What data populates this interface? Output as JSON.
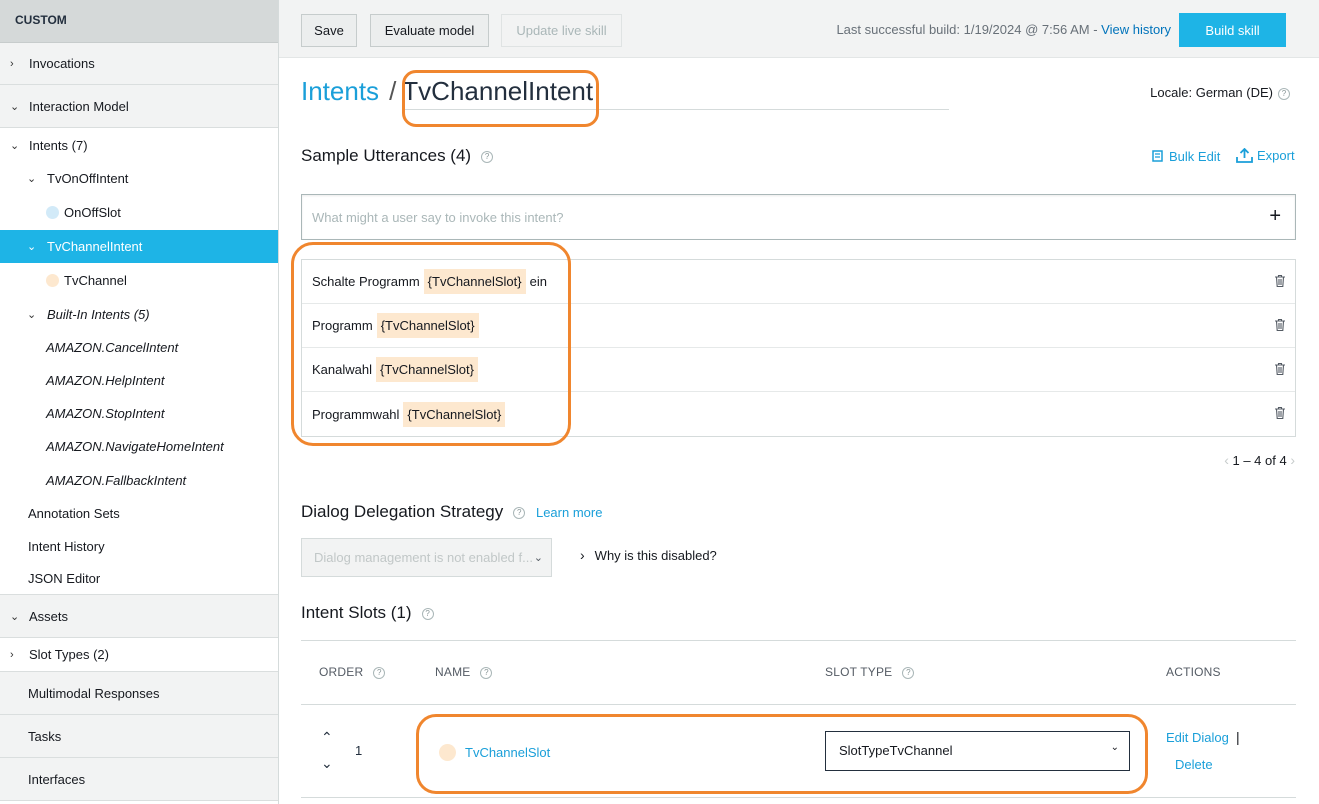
{
  "sidebar": {
    "header": "CUSTOM",
    "items": [
      {
        "label": "Invocations"
      },
      {
        "label": "Interaction Model"
      },
      {
        "label": "Intents (7)"
      },
      {
        "label": "TvOnOffIntent"
      },
      {
        "label": "OnOffSlot"
      },
      {
        "label": "TvChannelIntent"
      },
      {
        "label": "TvChannel"
      },
      {
        "label": "Built-In Intents (5)"
      },
      {
        "label": "AMAZON.CancelIntent"
      },
      {
        "label": "AMAZON.HelpIntent"
      },
      {
        "label": "AMAZON.StopIntent"
      },
      {
        "label": "AMAZON.NavigateHomeIntent"
      },
      {
        "label": "AMAZON.FallbackIntent"
      },
      {
        "label": "Annotation Sets"
      },
      {
        "label": "Intent History"
      },
      {
        "label": "JSON Editor"
      },
      {
        "label": "Assets"
      },
      {
        "label": "Slot Types (2)"
      },
      {
        "label": "Multimodal Responses"
      },
      {
        "label": "Tasks"
      },
      {
        "label": "Interfaces"
      }
    ]
  },
  "toolbar": {
    "save": "Save",
    "evaluate": "Evaluate model",
    "update": "Update live skill",
    "build_info": "Last successful build: 1/19/2024 @ 7:56 AM -",
    "view_history": "View history",
    "build": "Build skill"
  },
  "breadcrumb": {
    "parent": "Intents",
    "separator": "/",
    "current": "TvChannelIntent"
  },
  "locale": "Locale: German (DE)",
  "utterances": {
    "title": "Sample Utterances (4)",
    "bulk_edit": "Bulk Edit",
    "export": "Export",
    "placeholder": "What might a user say to invoke this intent?",
    "rows": [
      {
        "before": "Schalte Programm",
        "slot": "{TvChannelSlot}",
        "after": "ein"
      },
      {
        "before": "Programm",
        "slot": "{TvChannelSlot}",
        "after": ""
      },
      {
        "before": "Kanalwahl",
        "slot": "{TvChannelSlot}",
        "after": ""
      },
      {
        "before": "Programmwahl",
        "slot": "{TvChannelSlot}",
        "after": ""
      }
    ],
    "pager": "1 – 4 of 4"
  },
  "dialog": {
    "title": "Dialog Delegation Strategy",
    "learn_more": "Learn more",
    "select_value": "Dialog management is not enabled f...",
    "why": "Why is this disabled?"
  },
  "slots": {
    "title": "Intent Slots (1)",
    "headers": {
      "order": "ORDER",
      "name": "NAME",
      "type": "SLOT TYPE",
      "actions": "ACTIONS"
    },
    "rows": [
      {
        "order": "1",
        "name": "TvChannelSlot",
        "type": "SlotTypeTvChannel",
        "edit": "Edit Dialog",
        "delete": "Delete"
      }
    ]
  },
  "colors": {
    "accent": "#1eb4e6",
    "link": "#1a9fd9",
    "slot_tag": "#fde8cf",
    "annotation": "#f0862e"
  }
}
